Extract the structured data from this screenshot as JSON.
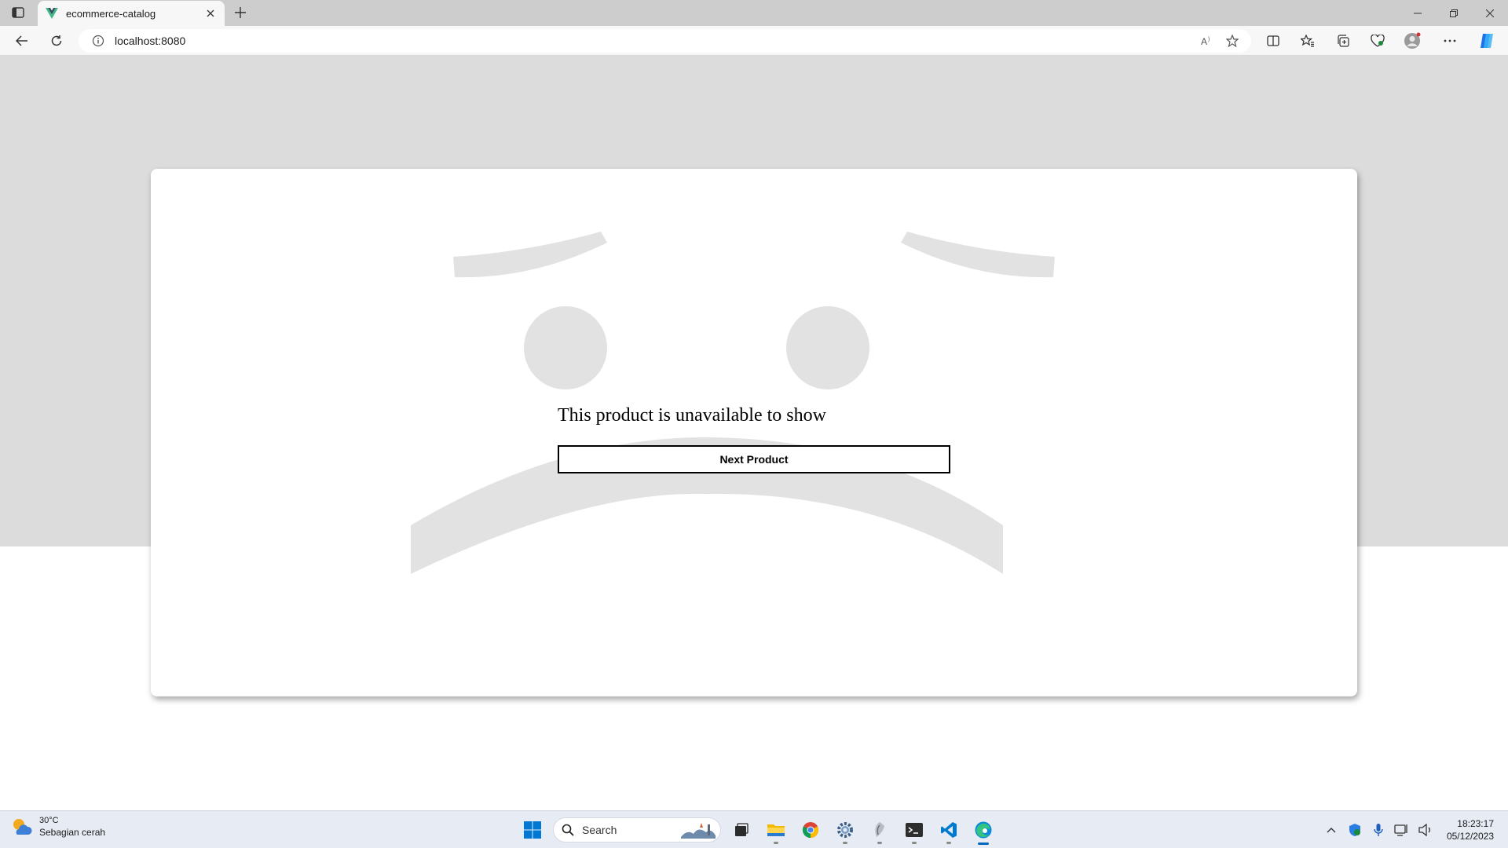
{
  "browser": {
    "tab": {
      "title": "ecommerce-catalog"
    },
    "address": {
      "url": "localhost:8080"
    }
  },
  "page": {
    "message": "This product is unavailable to show",
    "next_button": "Next Product"
  },
  "taskbar": {
    "weather": {
      "temp": "30°C",
      "desc": "Sebagian cerah"
    },
    "search": {
      "label": "Search"
    },
    "clock": {
      "time": "18:23:17",
      "date": "05/12/2023"
    }
  },
  "colors": {
    "page_gray": "#dcdcdc",
    "face_gray": "#e2e2e2",
    "accent": "#0067c0"
  }
}
